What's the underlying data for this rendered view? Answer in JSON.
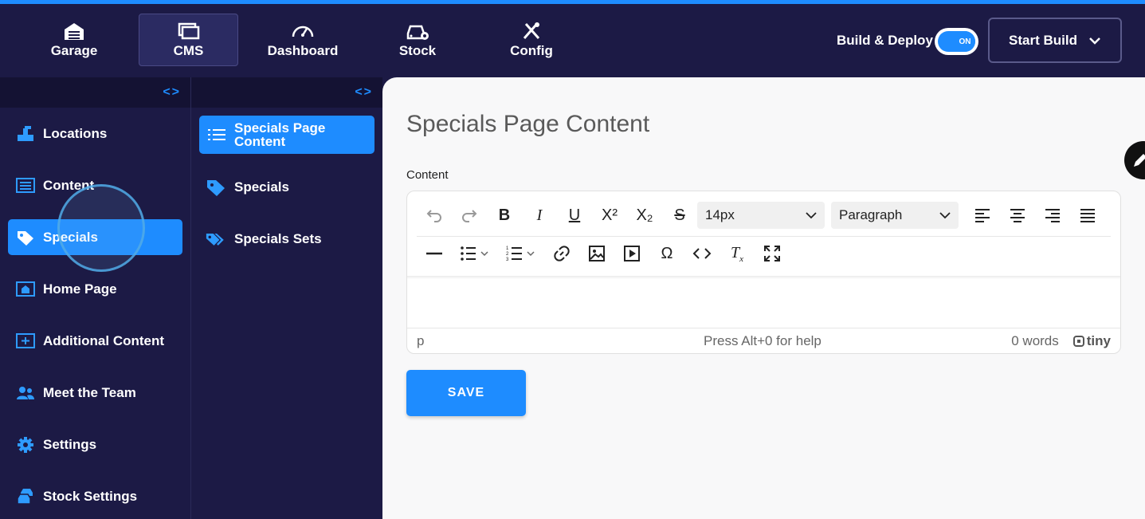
{
  "topnav": {
    "items": [
      {
        "label": "Garage",
        "icon": "garage-icon"
      },
      {
        "label": "CMS",
        "icon": "cms-icon",
        "active": true
      },
      {
        "label": "Dashboard",
        "icon": "dashboard-icon"
      },
      {
        "label": "Stock",
        "icon": "stock-icon"
      },
      {
        "label": "Config",
        "icon": "config-icon"
      }
    ],
    "build_deploy_label": "Build & Deploy",
    "toggle_text": "ON",
    "start_build_label": "Start Build"
  },
  "sidebar": {
    "collapse_glyph": "<>",
    "items": [
      {
        "label": "Locations",
        "icon": "locations-icon"
      },
      {
        "label": "Content",
        "icon": "content-icon"
      },
      {
        "label": "Specials",
        "icon": "tag-icon",
        "active": true
      },
      {
        "label": "Home Page",
        "icon": "home-page-icon"
      },
      {
        "label": "Additional Content",
        "icon": "add-content-icon"
      },
      {
        "label": "Meet the Team",
        "icon": "team-icon"
      },
      {
        "label": "Settings",
        "icon": "gear-icon"
      },
      {
        "label": "Stock Settings",
        "icon": "stock-settings-icon"
      }
    ]
  },
  "subnav": {
    "items": [
      {
        "label": "Specials Page Content",
        "icon": "list-icon",
        "active": true
      },
      {
        "label": "Specials",
        "icon": "tag-icon"
      },
      {
        "label": "Specials Sets",
        "icon": "tags-icon"
      }
    ]
  },
  "main": {
    "title": "Specials Page Content",
    "content_label": "Content",
    "editor": {
      "font_size": "14px",
      "block_format": "Paragraph",
      "status_path": "p",
      "status_help": "Press Alt+0 for help",
      "word_count": "0 words",
      "brand": "tiny"
    },
    "save_label": "SAVE"
  },
  "colors": {
    "accent": "#1e8cff",
    "nav_bg": "#1c1a45",
    "main_bg": "#f8f8f9"
  }
}
